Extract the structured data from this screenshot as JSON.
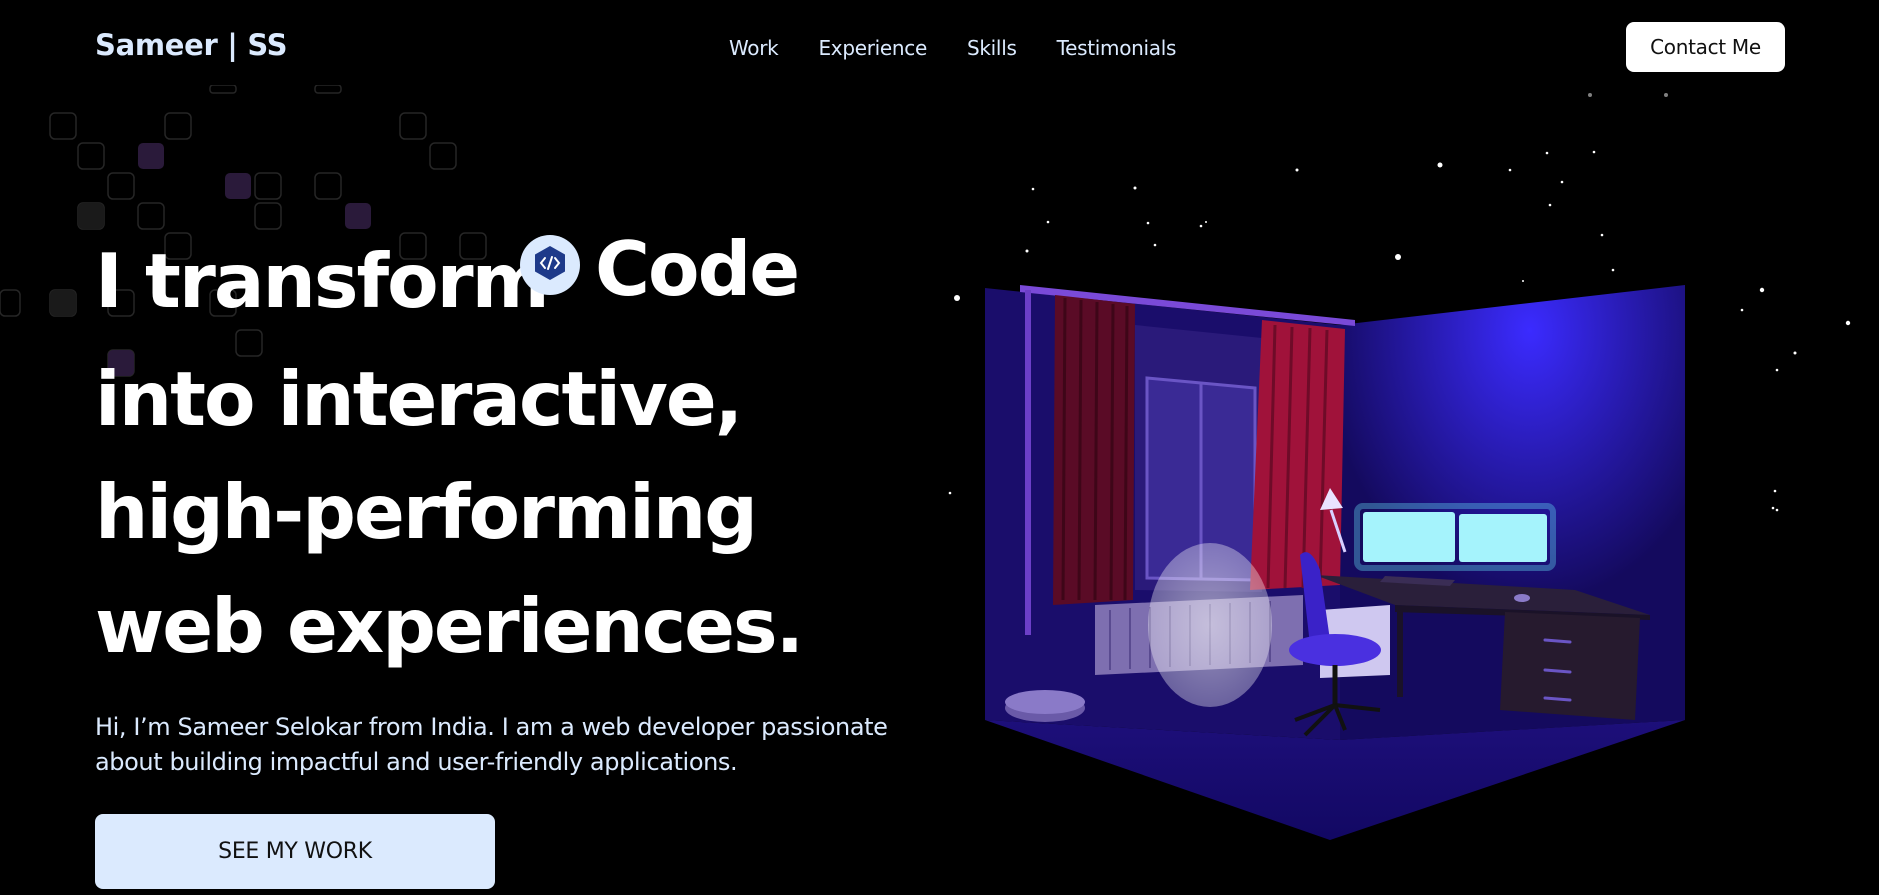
{
  "nav": {
    "logo": "Sameer | SS",
    "links": [
      "Work",
      "Experience",
      "Skills",
      "Testimonials"
    ],
    "contact_label": "Contact Me"
  },
  "hero": {
    "line1_prefix": "I transform",
    "code_word": "Code",
    "line2": "into interactive,",
    "line3": "high-performing",
    "line4": "web experiences.",
    "intro_line1": "Hi, I’m Sameer Selokar from India. I am a web developer passionate",
    "intro_line2": "about building impactful and user-friendly applications.",
    "cta_label": "SEE MY WORK"
  },
  "colors": {
    "background": "#000000",
    "accent_light_blue": "#dbeafe",
    "room_purple": "#1a0a6b"
  },
  "icons": [
    "code-icon"
  ]
}
